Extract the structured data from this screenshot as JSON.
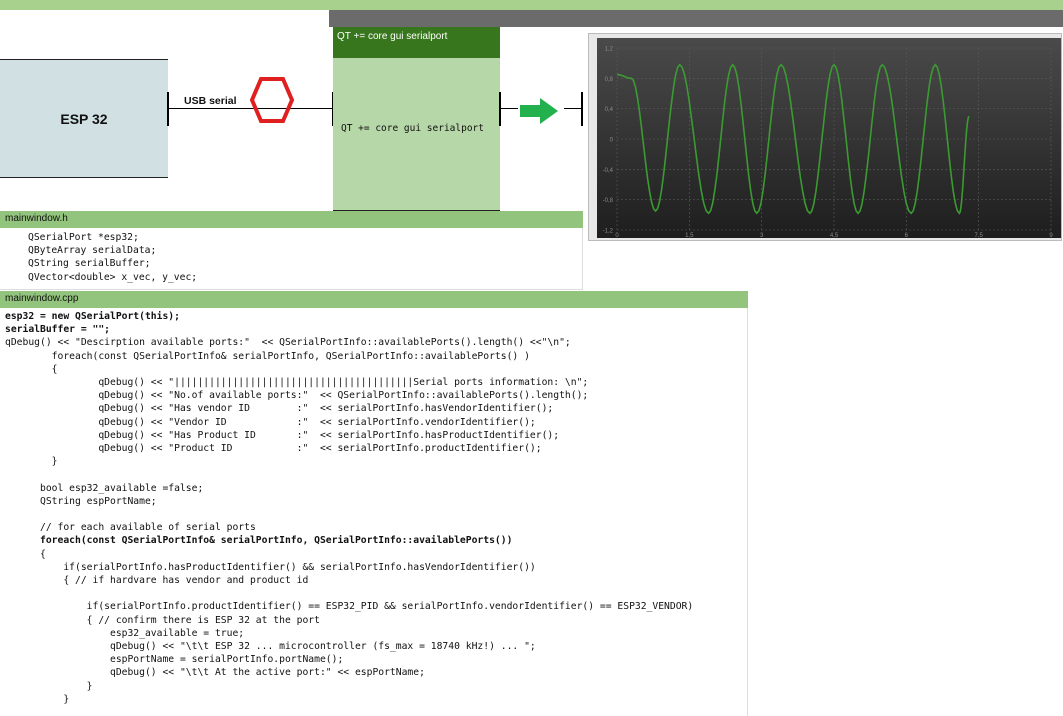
{
  "diagram": {
    "esp_label": "ESP 32",
    "usb_label": "USB serial",
    "qt_title": "QT += core gui serialport",
    "qt_label": "QT += core gui serialport",
    "colors": {
      "top_bar": "#a9d18e",
      "qt_title_bg": "#38761d",
      "qt_box_bg": "#b6d7a8",
      "esp_box_bg": "#d0e0e3",
      "hexagon": "#e02020",
      "arrow": "#22b14c"
    }
  },
  "plot": {
    "yticks": [
      "1,2",
      "0,8",
      "0,4",
      "0",
      "-0,4",
      "-0,8",
      "-1,2"
    ],
    "xticks": [
      "0",
      "1,5",
      "3",
      "4,5",
      "6",
      "7,5",
      "9"
    ]
  },
  "chart_data": {
    "type": "line",
    "title": "",
    "xlabel": "",
    "ylabel": "",
    "xlim": [
      0,
      9
    ],
    "ylim": [
      -1.2,
      1.2
    ],
    "grid": true,
    "series": [
      {
        "color": "#3c9a32",
        "description": "sinusoid approx 8 periods from x=0 to x=7.3",
        "points": [
          [
            0,
            0.85
          ],
          [
            0.3,
            0.8
          ],
          [
            0.8,
            -0.95
          ],
          [
            1.3,
            0.98
          ],
          [
            1.9,
            -0.98
          ],
          [
            2.4,
            0.98
          ],
          [
            2.9,
            -0.98
          ],
          [
            3.4,
            0.98
          ],
          [
            4.0,
            -0.98
          ],
          [
            4.5,
            0.98
          ],
          [
            5.0,
            -0.98
          ],
          [
            5.5,
            0.98
          ],
          [
            6.1,
            -0.98
          ],
          [
            6.6,
            0.98
          ],
          [
            7.1,
            -0.98
          ],
          [
            7.3,
            0.3
          ]
        ]
      }
    ]
  },
  "header_file": {
    "title": "mainwindow.h",
    "lines": [
      "QSerialPort *esp32;",
      "QByteArray serialData;",
      "QString serialBuffer;",
      "QVector<double> x_vec, y_vec;"
    ]
  },
  "cpp_file": {
    "title": "mainwindow.cpp",
    "lines": [
      "esp32 = new QSerialPort(this);",
      "serialBuffer = \"\";",
      "qDebug() << \"Descirption available ports:\"  << QSerialPortInfo::availablePorts().length() <<\"\\n\";",
      "        foreach(const QSerialPortInfo& serialPortInfo, QSerialPortInfo::availablePorts() )",
      "        {",
      "                qDebug() << \"|||||||||||||||||||||||||||||||||||||||||Serial ports information: \\n\";",
      "                qDebug() << \"No.of available ports:\"  << QSerialPortInfo::availablePorts().length();",
      "                qDebug() << \"Has vendor ID        :\"  << serialPortInfo.hasVendorIdentifier();",
      "                qDebug() << \"Vendor ID            :\"  << serialPortInfo.vendorIdentifier();",
      "                qDebug() << \"Has Product ID       :\"  << serialPortInfo.hasProductIdentifier();",
      "                qDebug() << \"Product ID           :\"  << serialPortInfo.productIdentifier();",
      "        }",
      "",
      "      bool esp32_available =false;",
      "      QString espPortName;",
      "",
      "      // for each available of serial ports",
      "      foreach(const QSerialPortInfo& serialPortInfo, QSerialPortInfo::availablePorts())",
      "      {",
      "          if(serialPortInfo.hasProductIdentifier() && serialPortInfo.hasVendorIdentifier())",
      "          { // if hardvare has vendor and product id",
      "",
      "              if(serialPortInfo.productIdentifier() == ESP32_PID && serialPortInfo.vendorIdentifier() == ESP32_VENDOR)",
      "              { // confirm there is ESP 32 at the port",
      "                  esp32_available = true;",
      "                  qDebug() << \"\\t\\t ESP 32 ... microcontroller (fs_max = 18740 kHz!) ... \";",
      "                  espPortName = serialPortInfo.portName();",
      "                  qDebug() << \"\\t\\t At the active port:\" << espPortName;",
      "              }",
      "          }"
    ]
  }
}
